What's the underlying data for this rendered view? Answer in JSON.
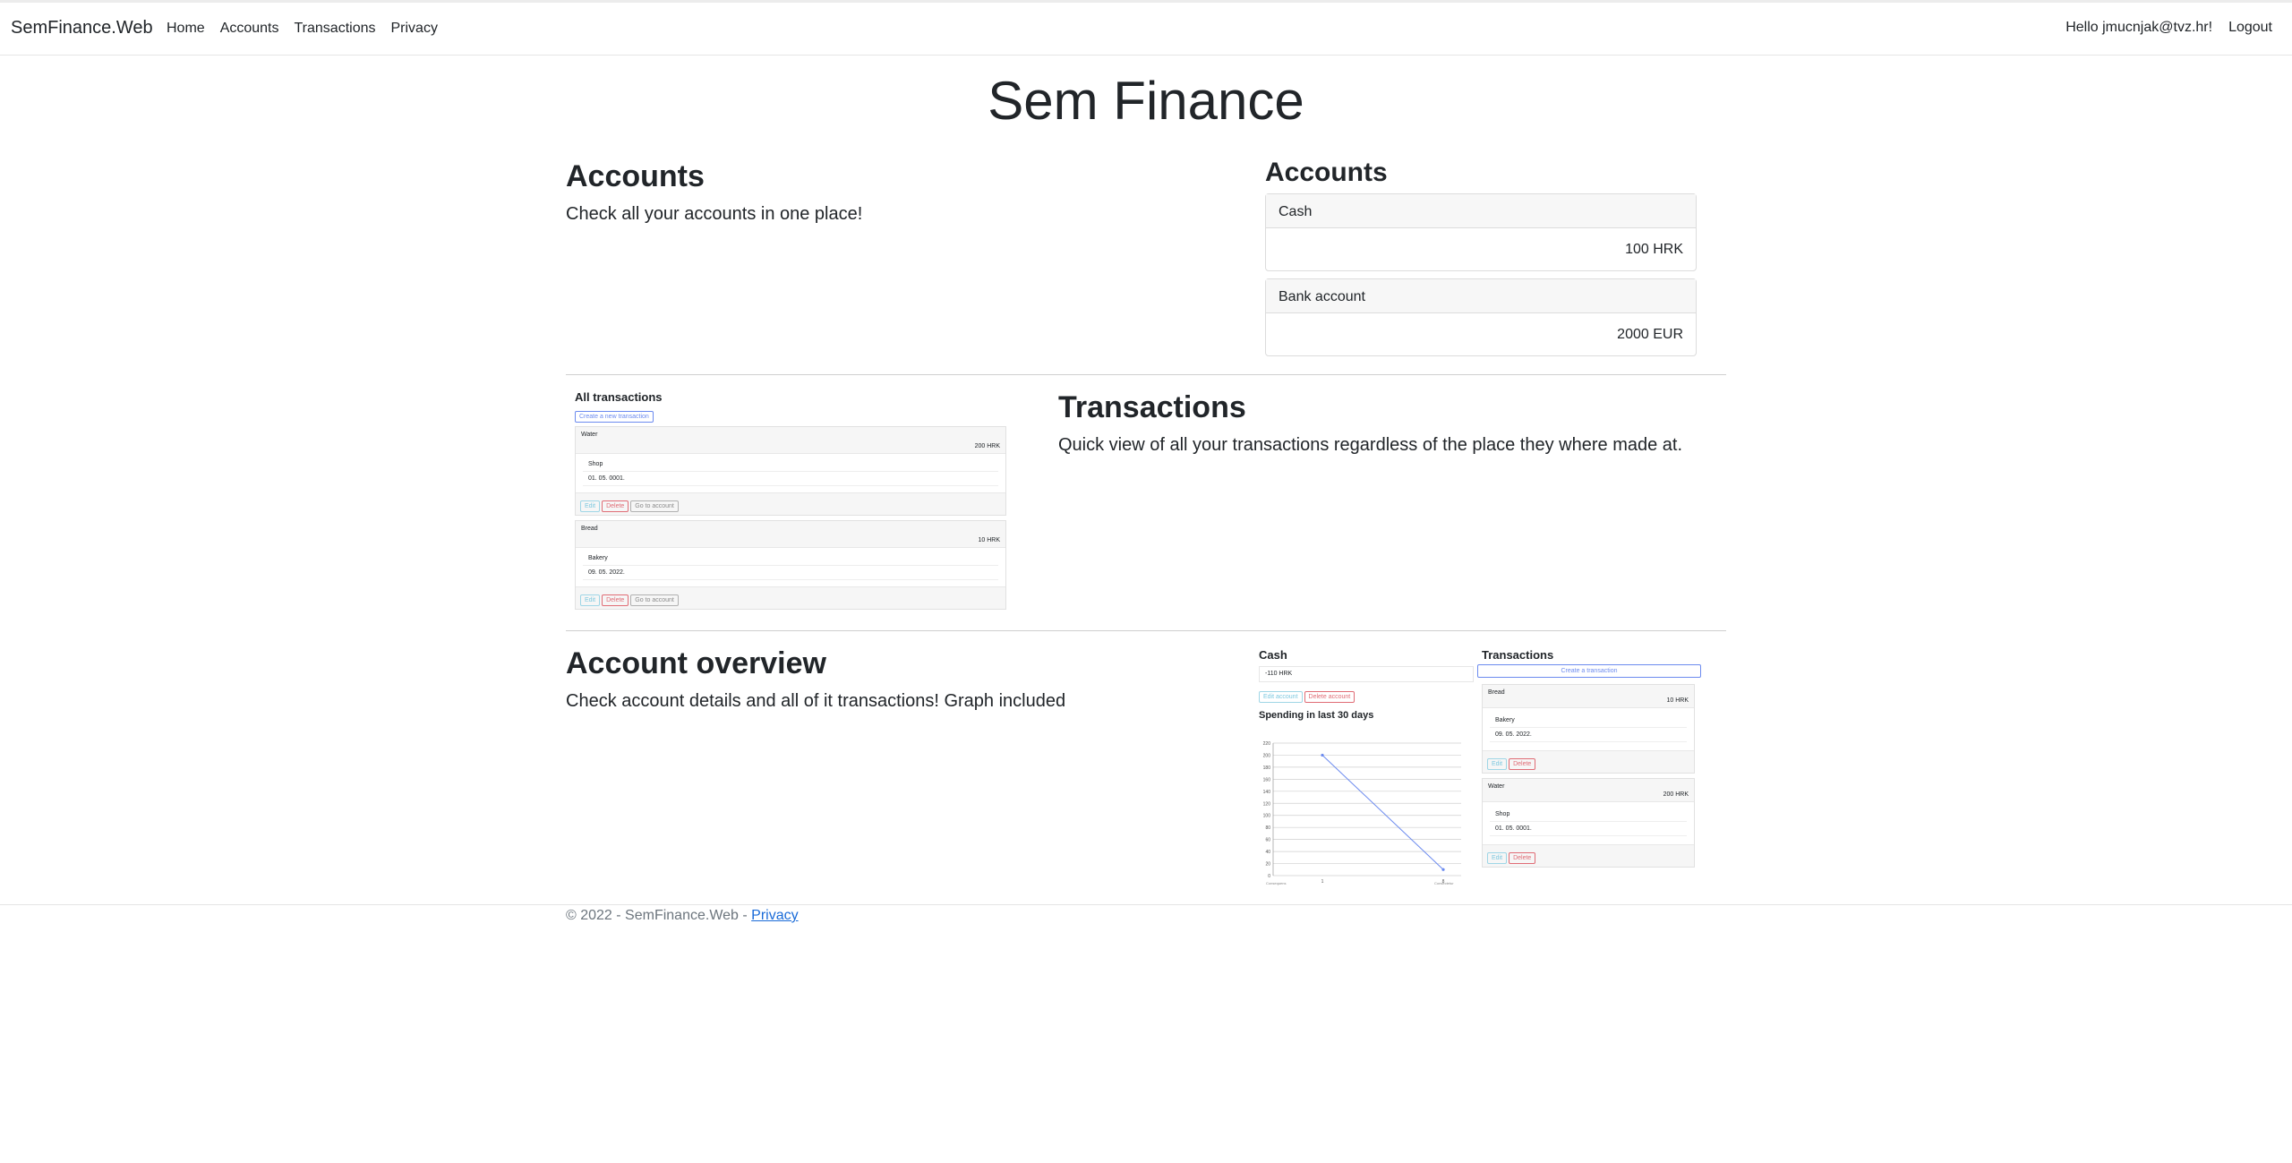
{
  "navbar": {
    "brand": "SemFinance.Web",
    "links": [
      "Home",
      "Accounts",
      "Transactions",
      "Privacy"
    ],
    "greeting": "Hello jmucnjak@tvz.hr!",
    "logout": "Logout"
  },
  "page_title": "Sem Finance",
  "accounts_section": {
    "heading": "Accounts",
    "description": "Check all your accounts in one place!",
    "preview_heading": "Accounts",
    "cards": [
      {
        "name": "Cash",
        "amount": "100 HRK"
      },
      {
        "name": "Bank account",
        "amount": "2000 EUR"
      }
    ]
  },
  "transactions_section": {
    "heading": "Transactions",
    "description": "Quick view of all your transactions regardless of the place they where made at.",
    "preview": {
      "title": "All transactions",
      "create_button": "Create a new transaction",
      "items": [
        {
          "name": "Water",
          "amount": "200 HRK",
          "place": "Shop",
          "date": "01. 05. 0001.",
          "buttons": [
            "Edit",
            "Delete",
            "Go to account"
          ]
        },
        {
          "name": "Bread",
          "amount": "10 HRK",
          "place": "Bakery",
          "date": "09. 05. 2022.",
          "buttons": [
            "Edit",
            "Delete",
            "Go to account"
          ]
        }
      ]
    }
  },
  "overview_section": {
    "heading": "Account overview",
    "description": "Check account details and all of it transactions! Graph included",
    "preview": {
      "account_title": "Cash",
      "balance": "-110 HRK",
      "edit_button": "Edit account",
      "delete_button": "Delete account",
      "chart_title": "Spending in last 30 days",
      "transactions_title": "Transactions",
      "create_button": "Create a transaction",
      "items": [
        {
          "name": "Bread",
          "amount": "10 HRK",
          "place": "Bakery",
          "date": "09. 05. 2022.",
          "buttons": [
            "Edit",
            "Delete"
          ]
        },
        {
          "name": "Water",
          "amount": "200 HRK",
          "place": "Shop",
          "date": "01. 05. 0001.",
          "buttons": [
            "Edit",
            "Delete"
          ]
        }
      ]
    }
  },
  "chart_data": {
    "type": "line",
    "title": "Spending in last 30 days",
    "x": [
      "1",
      "8"
    ],
    "series": [
      {
        "values": [
          200,
          10
        ]
      }
    ],
    "ylim": [
      0,
      220
    ],
    "yticks": [
      0,
      20,
      40,
      60,
      80,
      100,
      120,
      140,
      160,
      180,
      200,
      220
    ],
    "x_edge_labels": [
      "Consequens",
      "Consectetur"
    ],
    "grid": true
  },
  "colors": {
    "primary": "#6c8bef",
    "danger": "#e06c75",
    "secondary": "#8a8a8a",
    "link": "#1a6bd8",
    "line": "#6c8bef"
  },
  "footer": {
    "text": "© 2022 - SemFinance.Web - ",
    "privacy": "Privacy"
  }
}
